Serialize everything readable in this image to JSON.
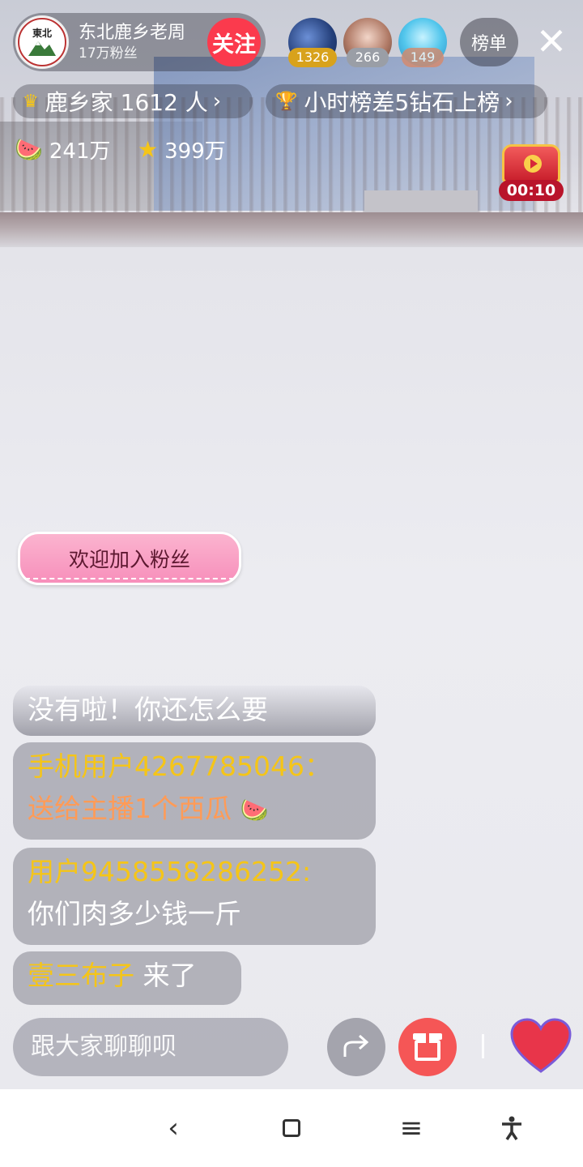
{
  "host": {
    "name": "东北鹿乡老周",
    "fans": "17万粉丝",
    "follow_label": "关注",
    "logo_text": "東北"
  },
  "viewers": [
    {
      "count": "1326",
      "badge_color": "#d8a21c"
    },
    {
      "count": "266",
      "badge_color": "#9a9ea6"
    },
    {
      "count": "149",
      "badge_color": "#d8896a"
    }
  ],
  "rank_label": "榜单",
  "close_icon": "close-icon",
  "fan_group": {
    "label": "鹿乡家 1612 人",
    "icon": "crown-icon"
  },
  "hour_rank": {
    "label": "小时榜差5钻石上榜",
    "icon": "trophy-icon"
  },
  "stats": {
    "melons": "241万",
    "stars": "399万"
  },
  "treasure": {
    "timer": "00:10"
  },
  "welcome": "欢迎加入粉丝",
  "chat": [
    {
      "text": "没有啦！你还怎么要"
    },
    {
      "user": "手机用户4267785046：",
      "text": "送给主播1个西瓜"
    },
    {
      "user": "用户9458558286252:",
      "text": "你们肉多少钱一斤"
    },
    {
      "user": "壹三布子",
      "text": "来了"
    }
  ],
  "input": {
    "placeholder": "跟大家聊聊呗"
  },
  "colors": {
    "accent": "#fb3a4d",
    "username": "#f5c518",
    "gift_text": "#ff9b57",
    "gift_button": "#f55656"
  }
}
